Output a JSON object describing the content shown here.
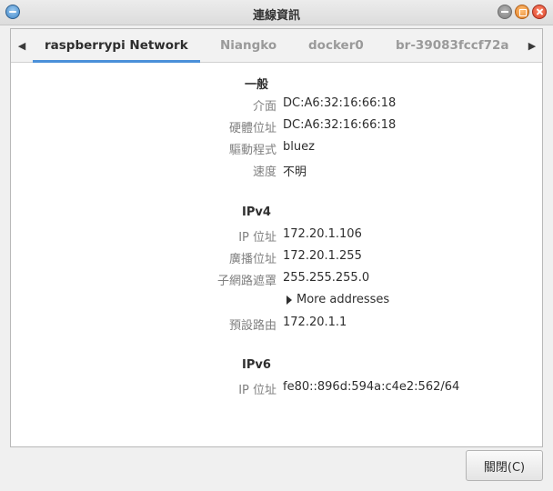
{
  "window": {
    "title": "連線資訊"
  },
  "tabs": [
    {
      "label": "raspberrypi Network",
      "active": true
    },
    {
      "label": "Niangko",
      "active": false
    },
    {
      "label": "docker0",
      "active": false
    },
    {
      "label": "br-39083fccf72a",
      "active": false
    }
  ],
  "general": {
    "title": "一般",
    "interface_label": "介面",
    "interface_value": "DC:A6:32:16:66:18",
    "hw_label": "硬體位址",
    "hw_value": "DC:A6:32:16:66:18",
    "driver_label": "驅動程式",
    "driver_value": "bluez",
    "speed_label": "速度",
    "speed_value": "不明"
  },
  "ipv4": {
    "title": "IPv4",
    "ip_label": "IP 位址",
    "ip_value": "172.20.1.106",
    "broadcast_label": "廣播位址",
    "broadcast_value": "172.20.1.255",
    "netmask_label": "子網路遮罩",
    "netmask_value": "255.255.255.0",
    "more_addresses": "More addresses",
    "gateway_label": "預設路由",
    "gateway_value": "172.20.1.1"
  },
  "ipv6": {
    "title": "IPv6",
    "ip_label": "IP 位址",
    "ip_value": "fe80::896d:594a:c4e2:562/64"
  },
  "footer": {
    "close_label": "關閉(C)"
  }
}
